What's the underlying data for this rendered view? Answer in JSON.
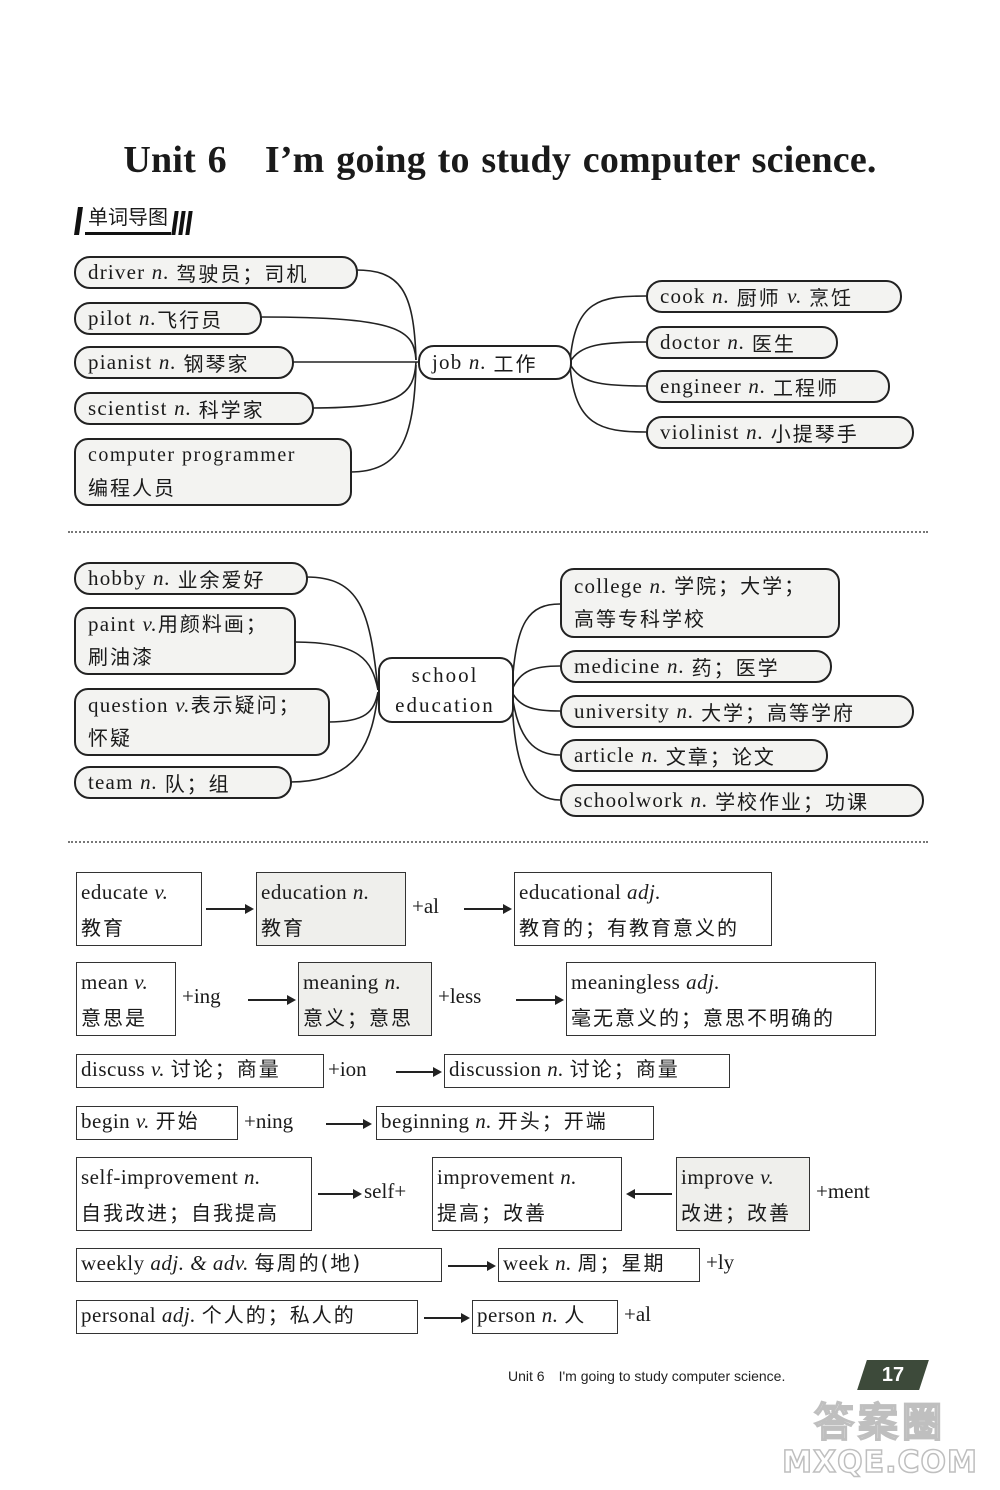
{
  "title": {
    "unit": "Unit 6",
    "text": "I’m going to study computer science."
  },
  "section_header": "单词导图",
  "mindmap_job": {
    "hub": {
      "en": "job",
      "pos": "n.",
      "zh": "工作"
    },
    "left": [
      {
        "en": "driver",
        "pos": "n.",
        "zh": "驾驶员；司机"
      },
      {
        "en": "pilot",
        "pos": "n.",
        "zh": "飞行员"
      },
      {
        "en": "pianist",
        "pos": "n.",
        "zh": "钢琴家"
      },
      {
        "en": "scientist",
        "pos": "n.",
        "zh": "科学家"
      },
      {
        "en": "computer programmer",
        "pos": "",
        "zh": "编程人员"
      }
    ],
    "right": [
      {
        "en": "cook",
        "pos": "n.",
        "zh": "厨师",
        "pos2": "v.",
        "zh2": "烹饪"
      },
      {
        "en": "doctor",
        "pos": "n.",
        "zh": "医生"
      },
      {
        "en": "engineer",
        "pos": "n.",
        "zh": "工程师"
      },
      {
        "en": "violinist",
        "pos": "n.",
        "zh": "小提琴手"
      }
    ]
  },
  "mindmap_school": {
    "hub": {
      "line1": "school",
      "line2": "education"
    },
    "left": [
      {
        "en": "hobby",
        "pos": "n.",
        "zh": "业余爱好"
      },
      {
        "en": "paint",
        "pos": "v.",
        "zh": "用颜料画；",
        "zh_line2": "刷油漆"
      },
      {
        "en": "question",
        "pos": "v.",
        "zh": "表示疑问；",
        "zh_line2": "怀疑"
      },
      {
        "en": "team",
        "pos": "n.",
        "zh": "队；组"
      }
    ],
    "right": [
      {
        "en": "college",
        "pos": "n.",
        "zh": "学院；大学；",
        "zh_line2": "高等专科学校"
      },
      {
        "en": "medicine",
        "pos": "n.",
        "zh": "药；医学"
      },
      {
        "en": "university",
        "pos": "n.",
        "zh": "大学；高等学府"
      },
      {
        "en": "article",
        "pos": "n.",
        "zh": "文章；论文"
      },
      {
        "en": "schoolwork",
        "pos": "n.",
        "zh": "学校作业；功课"
      }
    ]
  },
  "word_families": {
    "educate": {
      "base": {
        "en": "educate",
        "pos": "v.",
        "zh": "教育"
      },
      "mid": {
        "en": "education",
        "pos": "n.",
        "zh": "教育"
      },
      "op": "+al",
      "end": {
        "en": "educational",
        "pos": "adj.",
        "zh": "教育的；有教育意义的"
      }
    },
    "mean": {
      "base": {
        "en": "mean",
        "pos": "v.",
        "zh": "意思是"
      },
      "op1": "+ing",
      "mid": {
        "en": "meaning",
        "pos": "n.",
        "zh": "意义；意思"
      },
      "op2": "+less",
      "end": {
        "en": "meaningless",
        "pos": "adj.",
        "zh": "毫无意义的；意思不明确的"
      }
    },
    "discuss": {
      "base": {
        "en": "discuss",
        "pos": "v.",
        "zh": "讨论；商量"
      },
      "op": "+ion",
      "end": {
        "en": "discussion",
        "pos": "n.",
        "zh": "讨论；商量"
      }
    },
    "begin": {
      "base": {
        "en": "begin",
        "pos": "v.",
        "zh": "开始"
      },
      "op": "+ning",
      "end": {
        "en": "beginning",
        "pos": "n.",
        "zh": "开头；开端"
      }
    },
    "improve": {
      "left": {
        "en": "self-improvement",
        "pos": "n.",
        "zh": "自我改进；自我提高"
      },
      "op_left": "self+",
      "mid": {
        "en": "improvement",
        "pos": "n.",
        "zh": "提高；改善"
      },
      "right": {
        "en": "improve",
        "pos": "v.",
        "zh": "改进；改善"
      },
      "op_right": "+ment"
    },
    "week": {
      "left": {
        "en": "weekly",
        "pos": "adj. & adv.",
        "zh": "每周的(地)"
      },
      "right": {
        "en": "week",
        "pos": "n.",
        "zh": "周；星期"
      },
      "op": "+ly"
    },
    "person": {
      "left": {
        "en": "personal",
        "pos": "adj.",
        "zh": "个人的；私人的"
      },
      "right": {
        "en": "person",
        "pos": "n.",
        "zh": "人"
      },
      "op": "+al"
    }
  },
  "footer": {
    "unit": "Unit 6",
    "text": "I'm going to study computer science.",
    "page_number": "17"
  },
  "watermark": {
    "line1": "答案圈",
    "line2": "MXQE.COM"
  }
}
